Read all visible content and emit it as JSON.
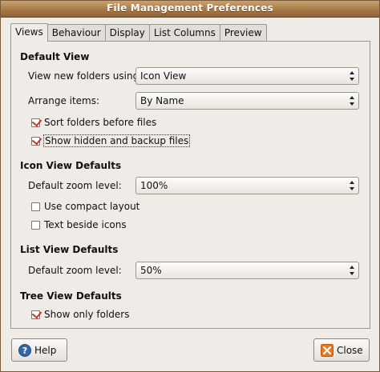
{
  "window": {
    "title": "File Management Preferences"
  },
  "tabs": [
    {
      "label": "Views",
      "active": true
    },
    {
      "label": "Behaviour",
      "active": false
    },
    {
      "label": "Display",
      "active": false
    },
    {
      "label": "List Columns",
      "active": false
    },
    {
      "label": "Preview",
      "active": false
    }
  ],
  "default_view": {
    "heading": "Default View",
    "view_new_folders_label": "View new folders using:",
    "view_new_folders_value": "Icon View",
    "arrange_items_label": "Arrange items:",
    "arrange_items_value": "By Name",
    "sort_folders_label": "Sort folders before files",
    "sort_folders_checked": true,
    "show_hidden_label": "Show hidden and backup files",
    "show_hidden_checked": true
  },
  "icon_view": {
    "heading": "Icon View Defaults",
    "zoom_label": "Default zoom level:",
    "zoom_value": "100%",
    "compact_label": "Use compact layout",
    "compact_checked": false,
    "text_beside_label": "Text beside icons",
    "text_beside_checked": false
  },
  "list_view": {
    "heading": "List View Defaults",
    "zoom_label": "Default zoom level:",
    "zoom_value": "50%"
  },
  "tree_view": {
    "heading": "Tree View Defaults",
    "show_only_folders_label": "Show only folders",
    "show_only_folders_checked": true
  },
  "buttons": {
    "help": "Help",
    "close": "Close"
  },
  "icons": {
    "help": "help-icon",
    "close": "close-icon",
    "combo_arrow": "combo-arrows-icon",
    "check": "checkmark-icon"
  },
  "colors": {
    "titlebar": "#a47744",
    "check": "#c0392b",
    "help_icon": "#3465a4",
    "close_icon": "#e9771f"
  }
}
